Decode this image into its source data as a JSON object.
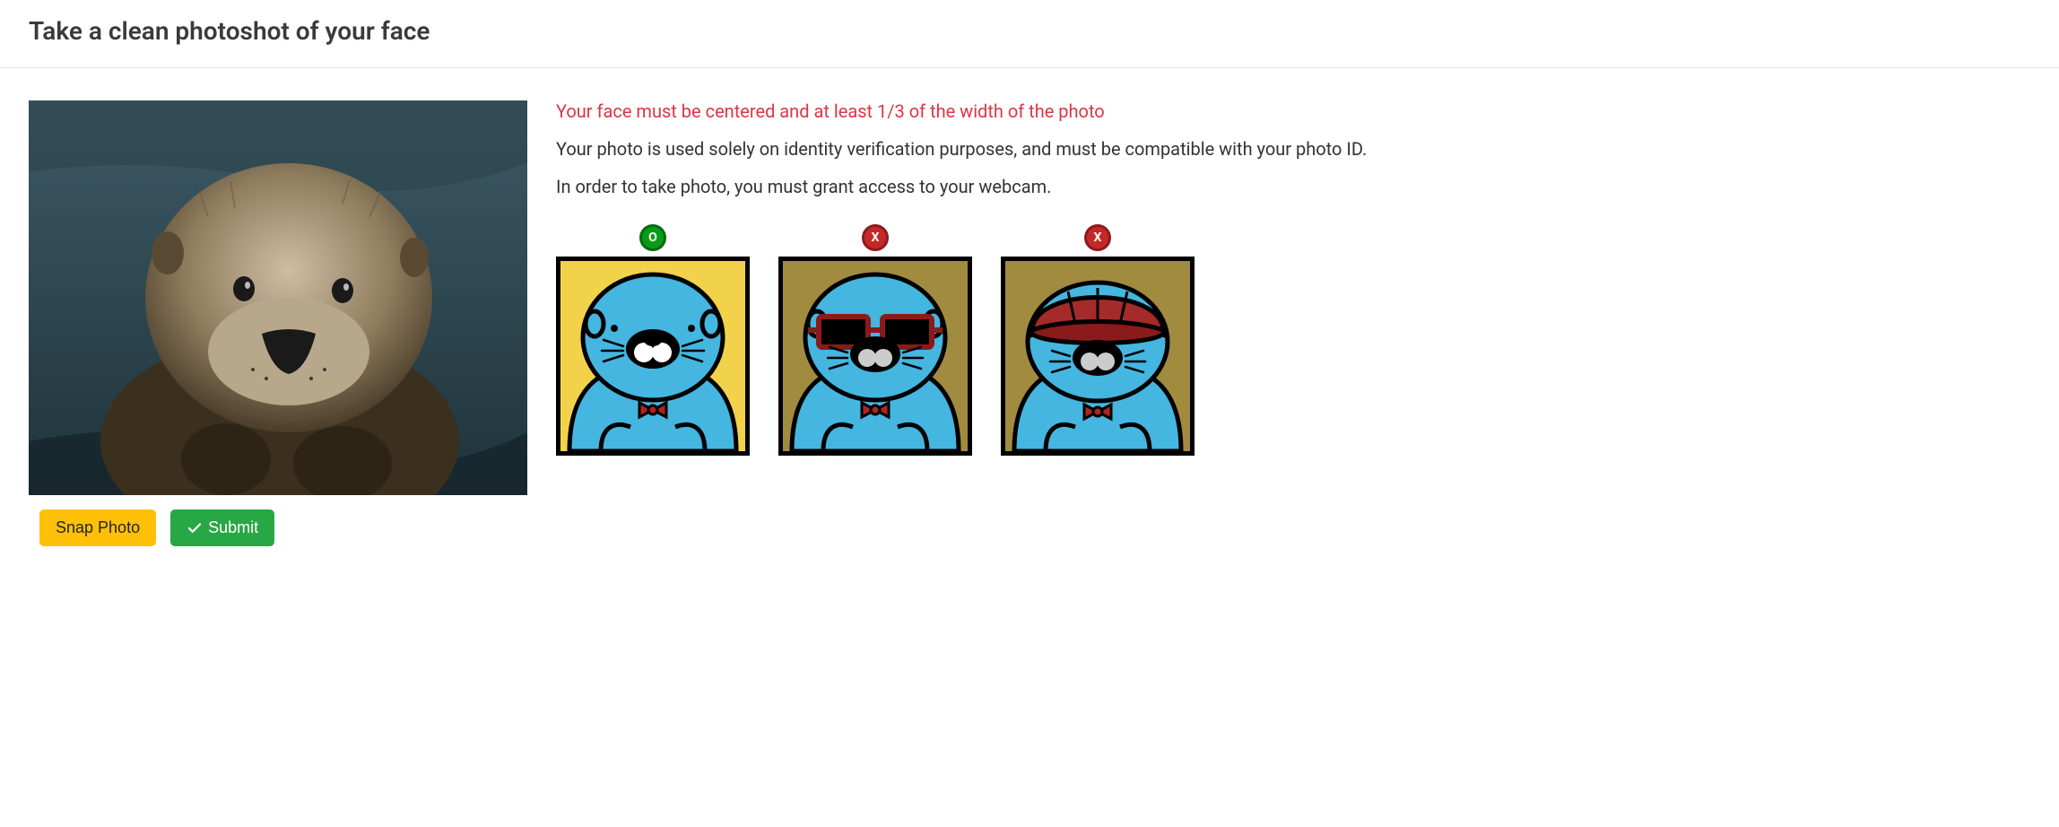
{
  "header": {
    "title": "Take a clean photoshot of your face"
  },
  "instructions": {
    "warning": "Your face must be centered and at least 1/3 of the width of the photo",
    "info1": "Your photo is used solely on identity verification purposes, and must be compatible with your photo ID.",
    "info2": "In order to take photo, you must grant access to your webcam."
  },
  "buttons": {
    "snap": "Snap Photo",
    "submit": "Submit"
  },
  "examples": [
    {
      "status": "ok",
      "label": "O"
    },
    {
      "status": "bad",
      "label": "X"
    },
    {
      "status": "bad",
      "label": "X"
    }
  ]
}
